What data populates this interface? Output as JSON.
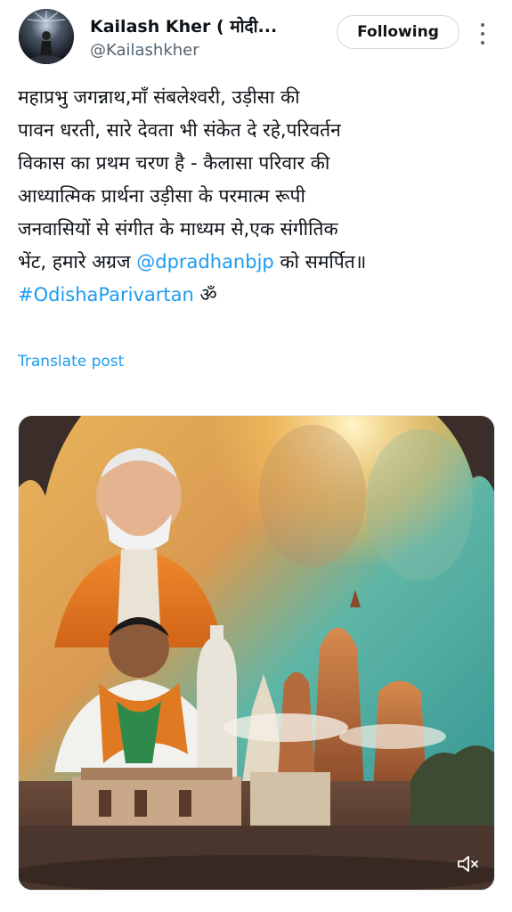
{
  "user": {
    "display_name": "Kailash Kher ( मोदी...",
    "handle": "@Kailashkher",
    "avatar_icon": "avatar-icon"
  },
  "actions": {
    "follow_label": "Following",
    "more_icon": "more-vertical-icon"
  },
  "tweet": {
    "line1": "महाप्रभु जगन्नाथ,माँ संबलेश्वरी, उड़ीसा की",
    "line2": "पावन धरती, सारे देवता भी संकेत दे रहे,परिवर्तन",
    "line3": "विकास का प्रथम चरण है - कैलासा परिवार की",
    "line4": "आध्यात्मिक प्रार्थना उड़ीसा के परमात्म रूपी",
    "line5": "जनवासियों से संगीत के माध्यम से,एक संगीतिक",
    "line6_before": "भेंट, हमारे अग्रज ",
    "mention": "@dpradhanbjp",
    "line6_after": " को समर्पित॥",
    "hashtag": "#OdishaParivartan",
    "hashtag_suffix": " ॐ",
    "translate_label": "Translate post"
  },
  "media": {
    "type": "video",
    "mute_icon": "volume-muted-icon"
  },
  "colors": {
    "link": "#1d9bf0",
    "text": "#0f1419",
    "secondary": "#536471"
  }
}
